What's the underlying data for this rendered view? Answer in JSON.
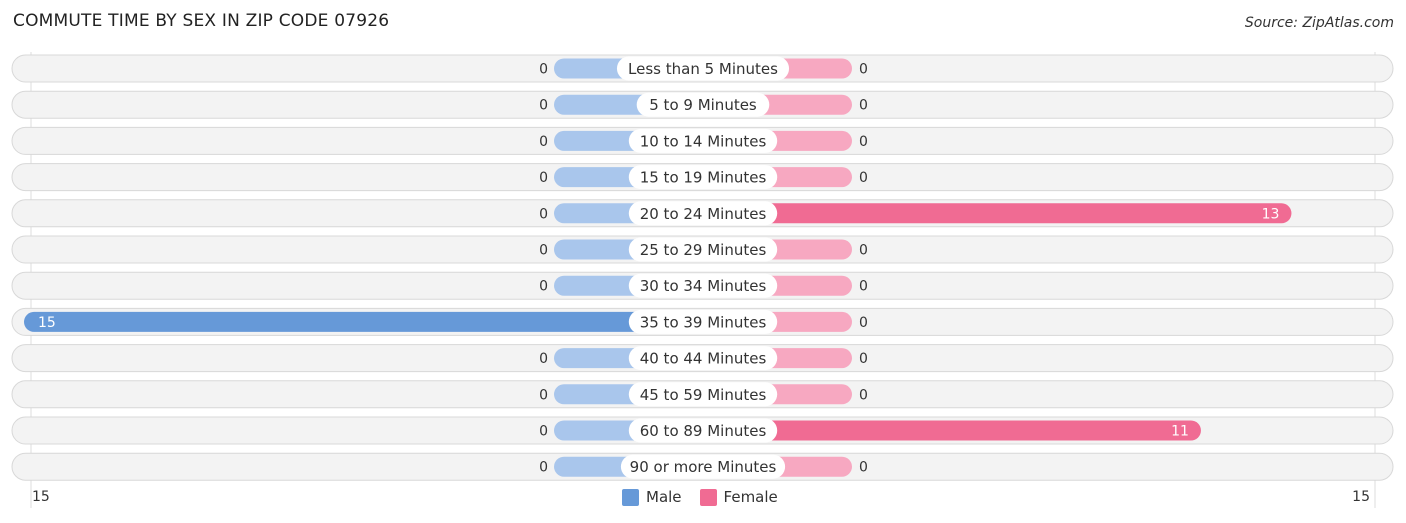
{
  "title": "COMMUTE TIME BY SEX IN ZIP CODE 07926",
  "source": "Source: ZipAtlas.com",
  "colors": {
    "male_bar": "#6699d8",
    "male_stub": "#a9c6ec",
    "female_bar": "#f06b93",
    "female_stub": "#f7a8c1",
    "row_bg": "#f3f3f3",
    "row_border": "#d8d8d8"
  },
  "legend": [
    {
      "label": "Male",
      "color": "#6699d8"
    },
    {
      "label": "Female",
      "color": "#f06b93"
    }
  ],
  "axis": {
    "left_label": "15",
    "right_label": "15"
  },
  "chart_data": {
    "type": "bar",
    "orientation": "horizontal-diverging",
    "title": "COMMUTE TIME BY SEX IN ZIP CODE 07926",
    "categories": [
      "Less than 5 Minutes",
      "5 to 9 Minutes",
      "10 to 14 Minutes",
      "15 to 19 Minutes",
      "20 to 24 Minutes",
      "25 to 29 Minutes",
      "30 to 34 Minutes",
      "35 to 39 Minutes",
      "40 to 44 Minutes",
      "45 to 59 Minutes",
      "60 to 89 Minutes",
      "90 or more Minutes"
    ],
    "series": [
      {
        "name": "Male",
        "values": [
          0,
          0,
          0,
          0,
          0,
          0,
          0,
          15,
          0,
          0,
          0,
          0
        ]
      },
      {
        "name": "Female",
        "values": [
          0,
          0,
          0,
          0,
          13,
          0,
          0,
          0,
          0,
          0,
          11,
          0
        ]
      }
    ],
    "xlim": [
      -15,
      15
    ],
    "legend_position": "bottom-center",
    "grid": false
  }
}
